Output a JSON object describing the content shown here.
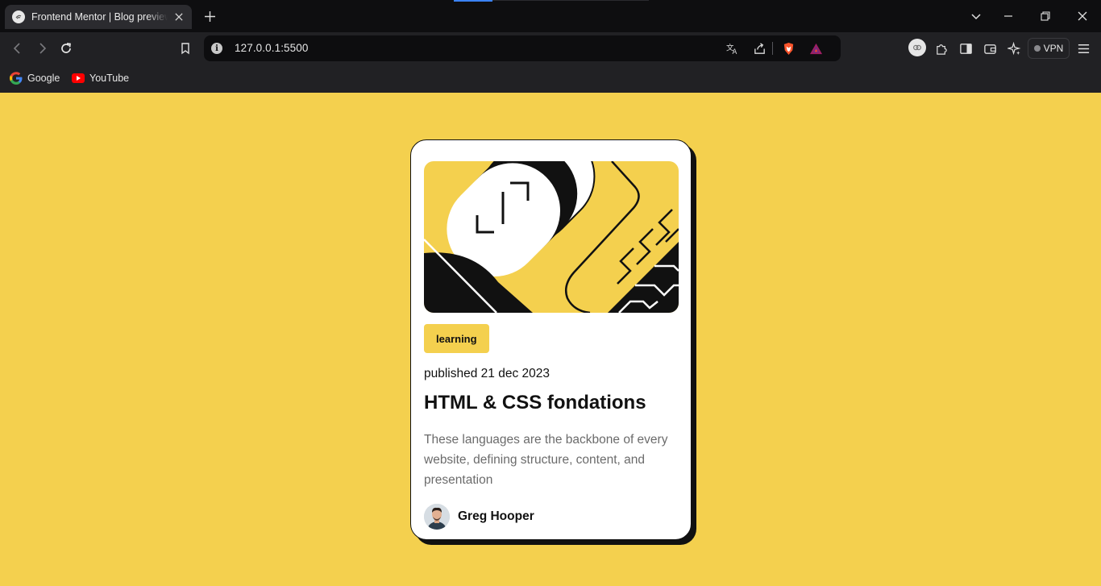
{
  "browser": {
    "tab_title": "Frontend Mentor | Blog preview card",
    "url": "127.0.0.1:5500",
    "vpn_label": "VPN",
    "bookmarks": [
      {
        "label": "Google",
        "icon": "google-icon"
      },
      {
        "label": "YouTube",
        "icon": "youtube-icon"
      }
    ]
  },
  "card": {
    "tag": "learning",
    "published": "published 21 dec 2023",
    "title": "HTML & CSS fondations",
    "description": "These languages are the backbone of every website, defining structure, content, and presentation",
    "author": "Greg Hooper"
  },
  "colors": {
    "page_background": "#f4d04e",
    "card_background": "#ffffff",
    "text_dark": "#111111",
    "text_muted": "#6b6b6b"
  }
}
